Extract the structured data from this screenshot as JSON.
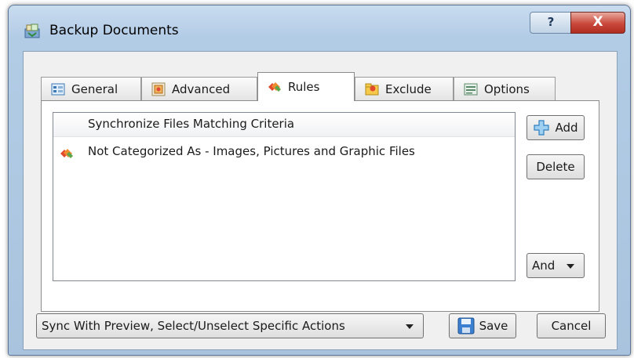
{
  "window": {
    "title": "Backup Documents",
    "help_glyph": "?",
    "close_glyph": "X"
  },
  "tabs": [
    {
      "label": "General",
      "icon": "general-icon"
    },
    {
      "label": "Advanced",
      "icon": "advanced-icon"
    },
    {
      "label": "Rules",
      "icon": "rules-icon",
      "selected": true
    },
    {
      "label": "Exclude",
      "icon": "exclude-icon"
    },
    {
      "label": "Options",
      "icon": "options-icon"
    }
  ],
  "rules": {
    "header": "Synchronize Files Matching Criteria",
    "items": [
      {
        "label": "Not Categorized As - Images, Pictures and Graphic Files",
        "icon": "rule-icon"
      }
    ],
    "add_label": "Add",
    "delete_label": "Delete",
    "logic_value": "And"
  },
  "footer": {
    "mode_value": "Sync With Preview, Select/Unselect Specific Actions",
    "save_label": "Save",
    "cancel_label": "Cancel"
  }
}
